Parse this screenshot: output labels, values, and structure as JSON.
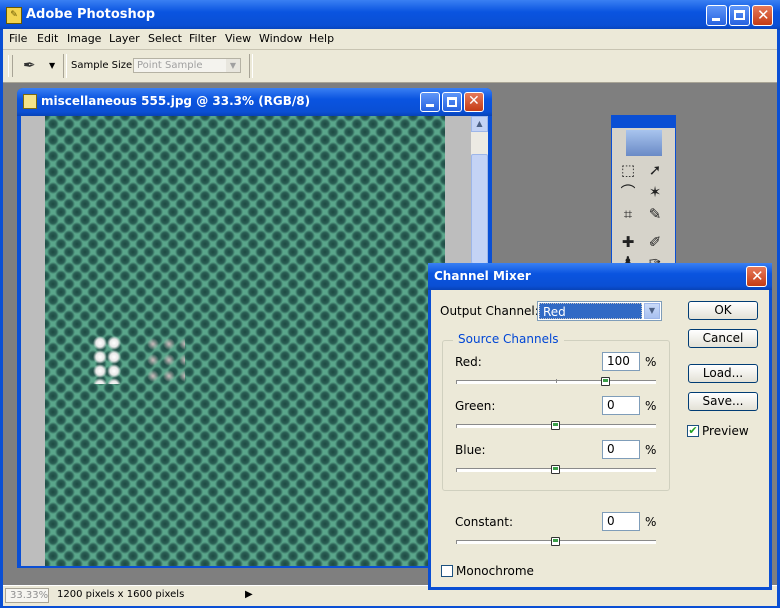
{
  "app": {
    "title": "Adobe Photoshop"
  },
  "menu": [
    "File",
    "Edit",
    "Image",
    "Layer",
    "Select",
    "Filter",
    "View",
    "Window",
    "Help"
  ],
  "options": {
    "sample_size_label": "Sample Size:",
    "sample_size_value": "Point Sample"
  },
  "document": {
    "title": "miscellaneous 555.jpg @ 33.3% (RGB/8)"
  },
  "status": {
    "zoom": "33.33%",
    "info": "1200 pixels x 1600 pixels"
  },
  "dialog": {
    "title": "Channel Mixer",
    "output_channel_label": "Output Channel:",
    "output_channel_value": "Red",
    "source_channels_label": "Source Channels",
    "channels": [
      {
        "label": "Red:",
        "value": "100",
        "unit": "%"
      },
      {
        "label": "Green:",
        "value": "0",
        "unit": "%"
      },
      {
        "label": "Blue:",
        "value": "0",
        "unit": "%"
      }
    ],
    "constant": {
      "label": "Constant:",
      "value": "0",
      "unit": "%"
    },
    "monochrome_label": "Monochrome",
    "monochrome_checked": false,
    "buttons": {
      "ok": "OK",
      "cancel": "Cancel",
      "load": "Load...",
      "save": "Save..."
    },
    "preview_label": "Preview",
    "preview_checked": true
  },
  "colors": {
    "xp_blue": "#0a4fd4",
    "dialog_bg": "#ece9d8",
    "image_teal": "#5aa68b"
  }
}
